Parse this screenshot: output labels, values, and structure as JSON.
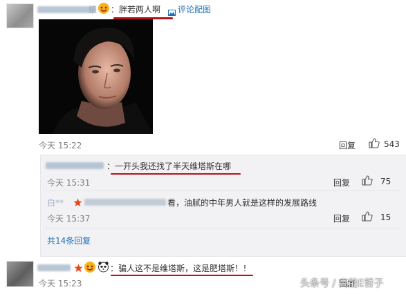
{
  "comment1": {
    "username": "小**娘",
    "text": "：胖若两人啊",
    "attach_label": "评论配图",
    "time": "今天 15:22",
    "reply_label": "回复",
    "like_count": "543"
  },
  "replies": [
    {
      "text": "：一开头我还找了半天维塔斯在哪",
      "time": "今天 15:31",
      "reply_label": "回复",
      "like_count": "75"
    },
    {
      "username": "白**",
      "text": "看，油腻的中年男人就是这样的发展路线",
      "time": "今天 15:37",
      "reply_label": "回复",
      "like_count": "15"
    }
  ],
  "more_replies": "共14条回复",
  "comment2": {
    "text": "：骗人这不是维塔斯，这是肥塔斯！！",
    "time": "今天 15:23",
    "reply_label": "回复"
  },
  "watermark": "头条号 / 高能E哲子",
  "colors": {
    "accent": "#eb7350",
    "highlight": "#b8101a",
    "link": "#1d6fb8"
  }
}
